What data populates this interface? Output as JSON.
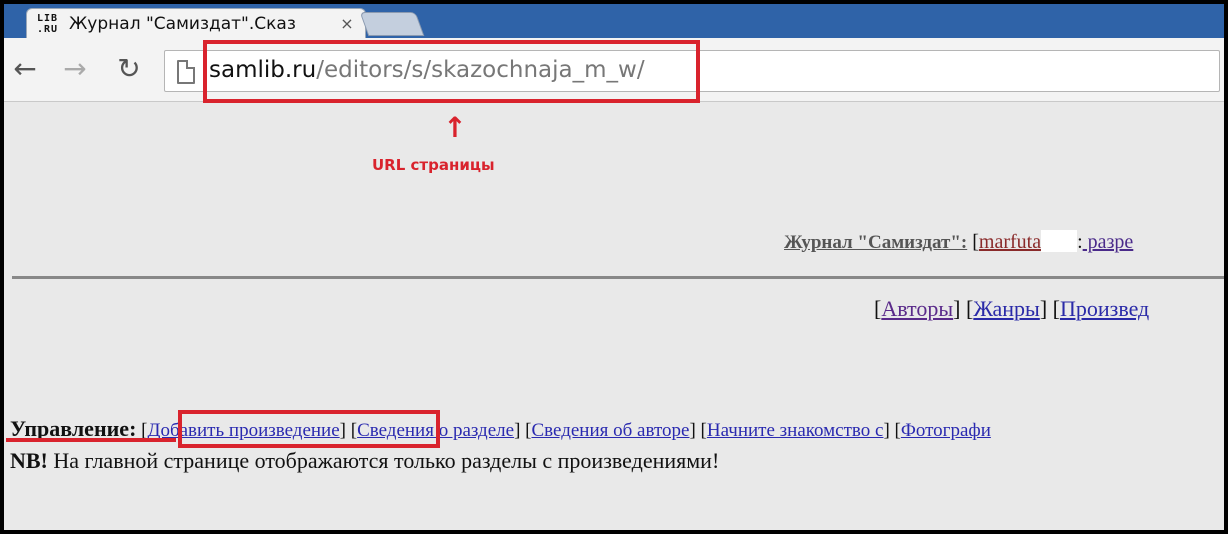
{
  "browser": {
    "tab": {
      "favicon_text": "LIB\n.RU",
      "title": "Журнал \"Самиздат\".Сказ",
      "close_glyph": "×"
    },
    "nav": {
      "back_glyph": "←",
      "forward_glyph": "→",
      "reload_glyph": "↻"
    },
    "url": {
      "host": "samlib.ru",
      "path": "/editors/s/skazochnaja_m_w/"
    }
  },
  "annotations": {
    "arrow_glyph": "↑",
    "url_label": "URL страницы",
    "color": "#d9232d"
  },
  "page": {
    "journal": {
      "name": "Журнал \"Самиздат\":",
      "open_bracket": " [",
      "user": "marfuta",
      "sep": ":",
      "section_link": " разре"
    },
    "nav": {
      "authors": "Авторы",
      "genres": "Жанры",
      "works": "Произвед"
    },
    "management": {
      "label": "Управление:",
      "links": {
        "add_work": "Добавить произведение",
        "section_info": "Сведения о разделе",
        "author_info": "Сведения об авторе",
        "start_acquaintance": "Начните знакомство с",
        "photo": "Фотографи"
      }
    },
    "nb": {
      "prefix": "NB!",
      "text": " На главной странице отображаются только разделы с произведениями!"
    }
  }
}
